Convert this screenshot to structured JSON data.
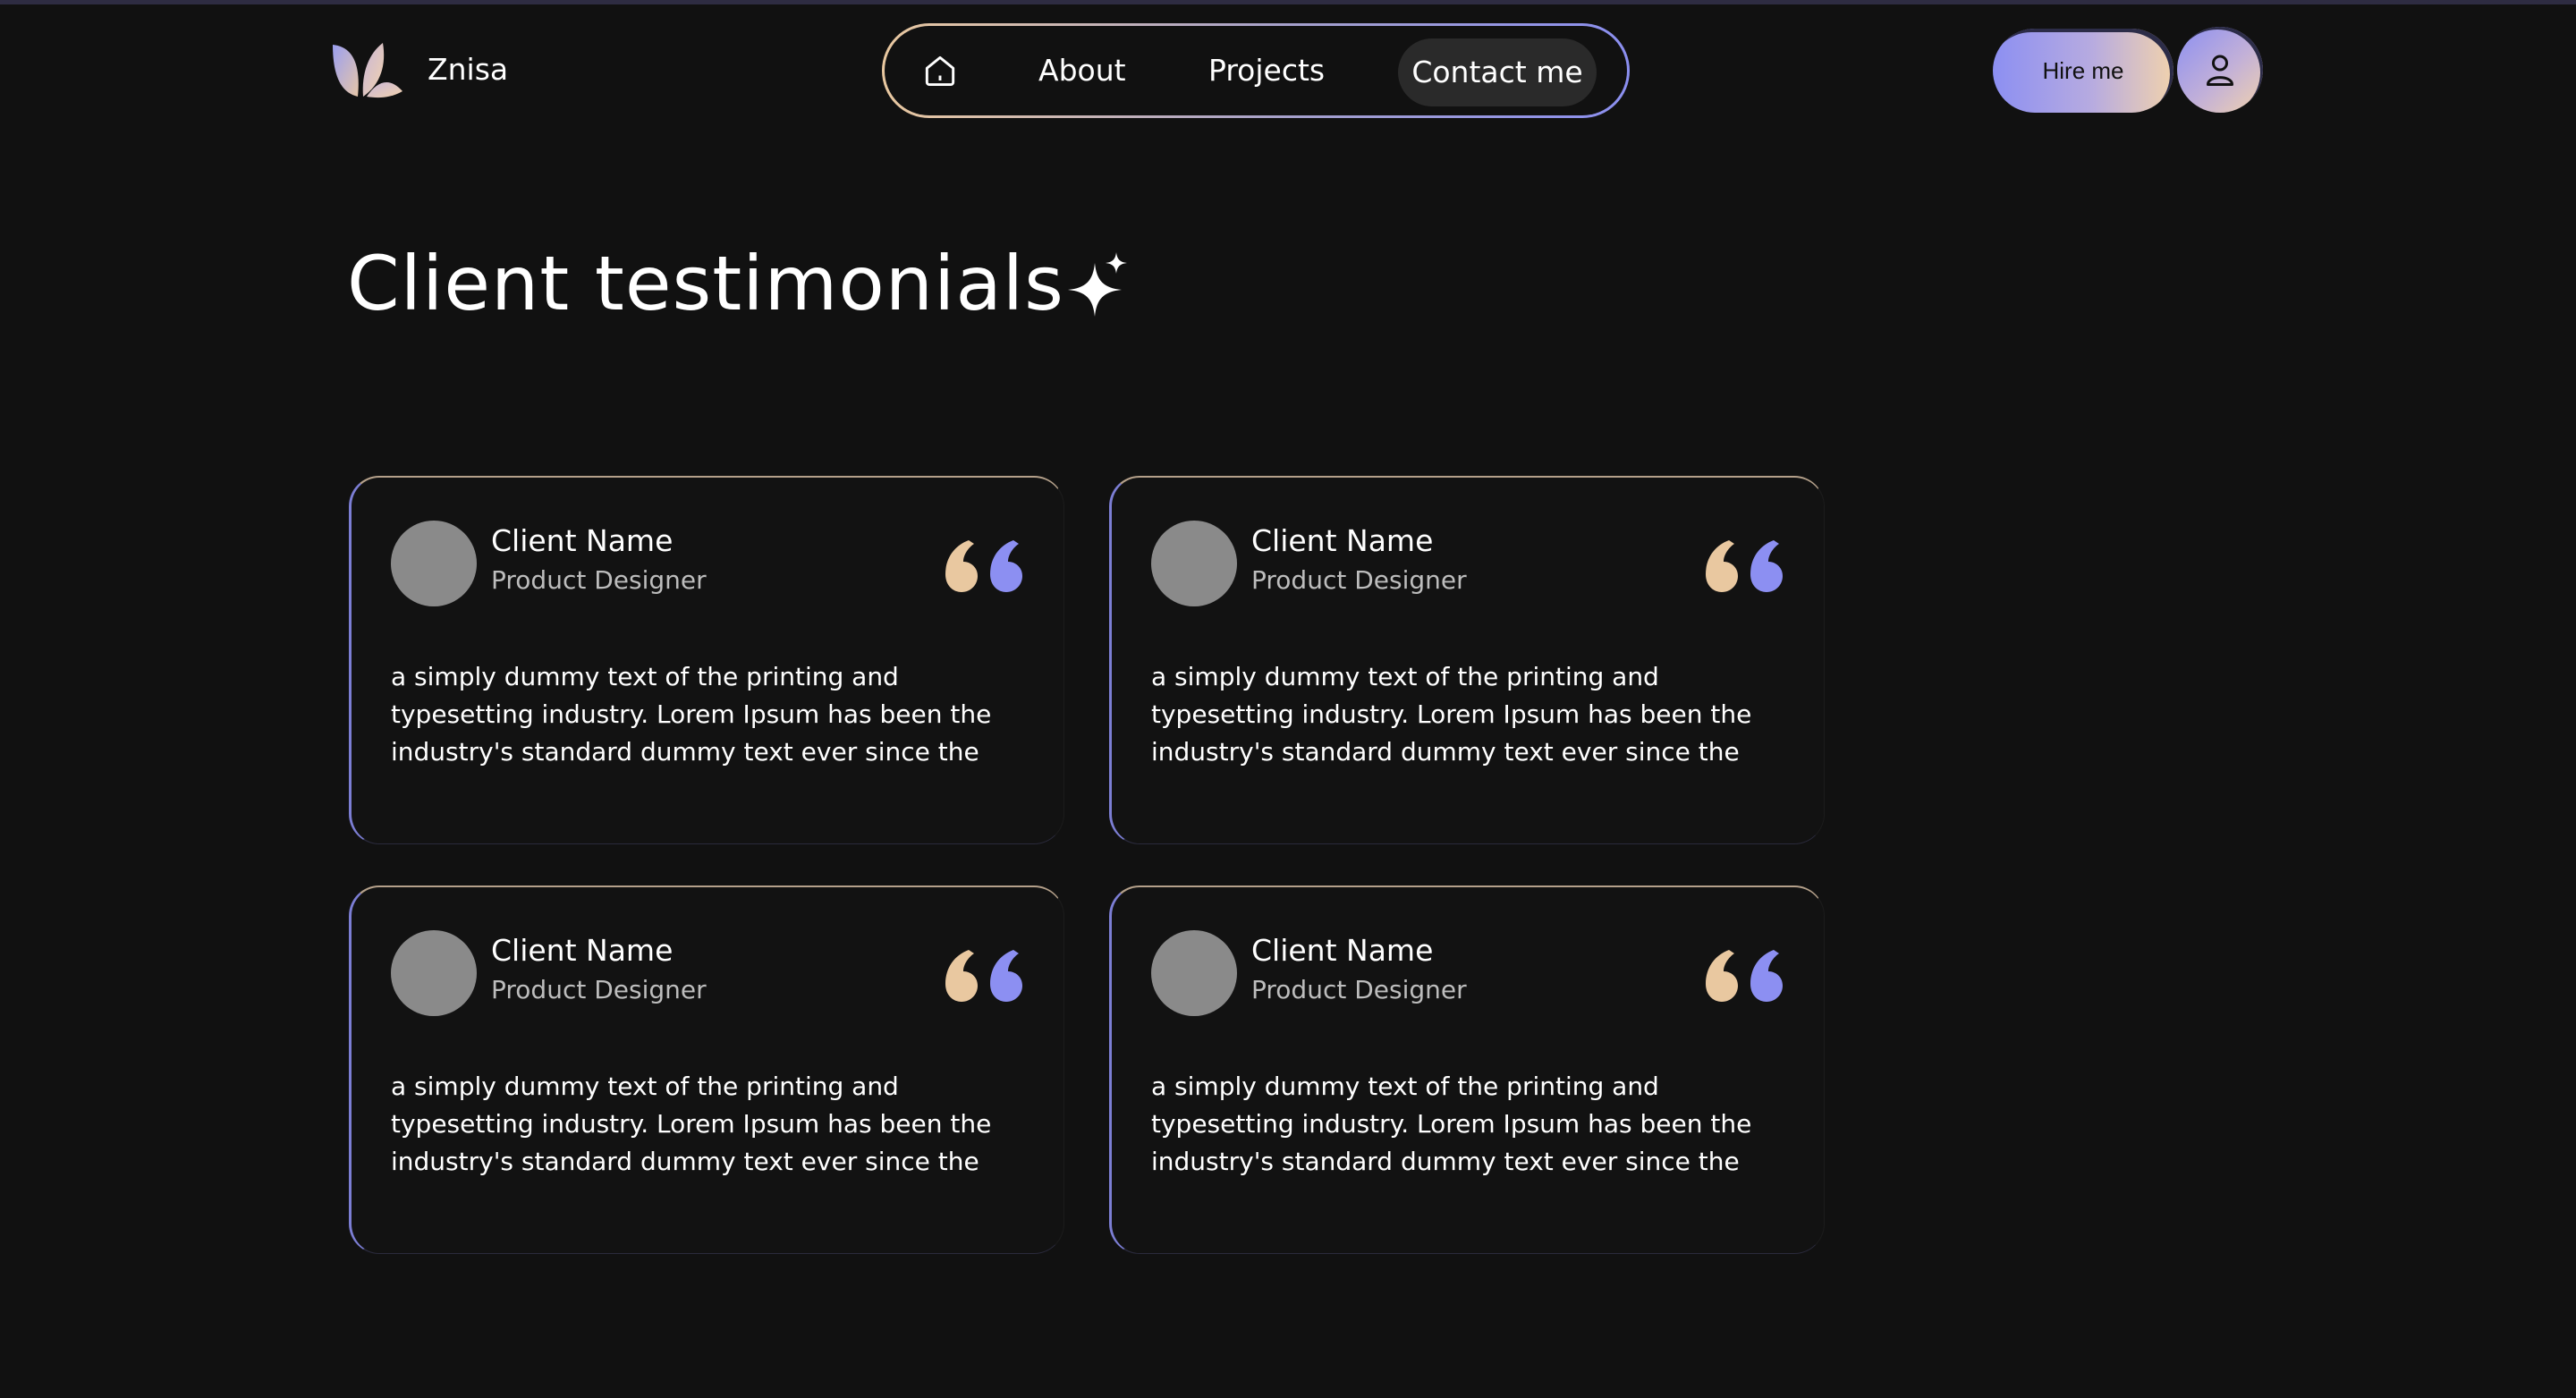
{
  "header": {
    "brand": "Znisa",
    "nav": {
      "home_icon": "home-icon",
      "items": [
        {
          "label": "About"
        },
        {
          "label": "Projects"
        },
        {
          "label": "Contact me",
          "active": true
        }
      ]
    },
    "hire_label": "Hire me",
    "profile_icon": "user-icon"
  },
  "section": {
    "title": "Client testimonials",
    "title_icon": "sparkle-icon"
  },
  "testimonials": [
    {
      "name": "Client Name",
      "role": "Product Designer",
      "text": "a simply dummy text of the printing and typesetting industry. Lorem Ipsum has been the industry's standard dummy text ever since the"
    },
    {
      "name": "Client Name",
      "role": "Product Designer",
      "text": "a simply dummy text of the printing and typesetting industry. Lorem Ipsum has been the industry's standard dummy text ever since the"
    },
    {
      "name": "Client Name",
      "role": "Product Designer",
      "text": "a simply dummy text of the printing and typesetting industry. Lorem Ipsum has been the industry's standard dummy text ever since the"
    },
    {
      "name": "Client Name",
      "role": "Product Designer",
      "text": "a simply dummy text of the printing and typesetting industry. Lorem Ipsum has been the industry's standard dummy text ever since the"
    }
  ],
  "colors": {
    "background": "#111111",
    "accent_blue": "#8c8ff2",
    "accent_peach": "#f1d2ad",
    "avatar_gray": "#8a8a8a"
  }
}
